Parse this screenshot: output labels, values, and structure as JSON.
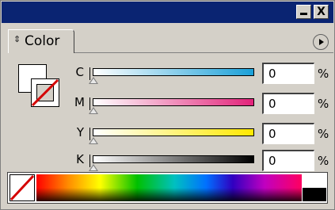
{
  "window": {
    "minimize_label": "",
    "close_label": "X"
  },
  "tab": {
    "label": "Color"
  },
  "sliders": [
    {
      "label": "C",
      "value": "0",
      "unit": "%",
      "gradient_end": "#1ba0d8"
    },
    {
      "label": "M",
      "value": "0",
      "unit": "%",
      "gradient_end": "#e2237a"
    },
    {
      "label": "Y",
      "value": "0",
      "unit": "%",
      "gradient_end": "#ffe800"
    },
    {
      "label": "K",
      "value": "0",
      "unit": "%",
      "gradient_end": "#000000"
    }
  ],
  "colors": {
    "titlebar": "#0a2472",
    "panel": "#d4d0c8",
    "none_slash": "#d40000"
  },
  "icons": [
    "minimize-icon",
    "close-icon",
    "panel-menu-icon",
    "none-swatch-icon",
    "tab-arrows-icon"
  ]
}
